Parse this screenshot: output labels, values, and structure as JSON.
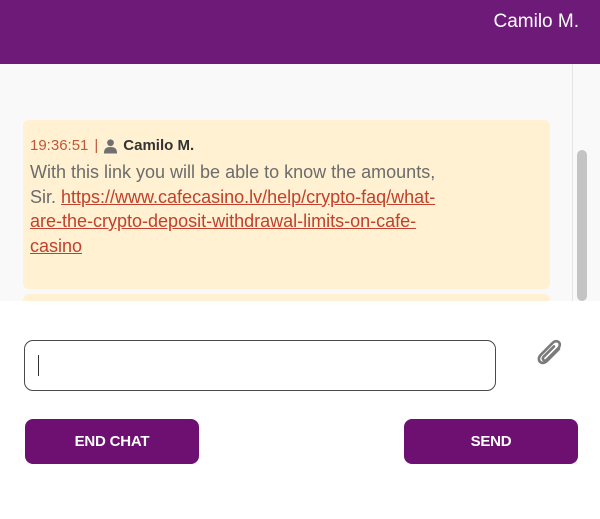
{
  "header": {
    "agent_name": "Camilo M."
  },
  "message": {
    "time": "19:36:51",
    "separator": "|",
    "author": "Camilo M.",
    "text_before_link": "With this link you will be able to know the amounts, Sir. ",
    "link": "https://www.cafecasino.lv/help/crypto-faq/what-are-the-crypto-deposit-withdrawal-limits-on-cafe-casino"
  },
  "input": {
    "value": "",
    "placeholder": ""
  },
  "buttons": {
    "end_chat": "END CHAT",
    "send": "SEND"
  },
  "icons": {
    "user": "user-icon",
    "attach": "paperclip-icon"
  },
  "colors": {
    "header_bg": "#6e1a78",
    "button_bg": "#6e0f72",
    "message_bg": "#fff1d1",
    "link": "#c2402c"
  }
}
